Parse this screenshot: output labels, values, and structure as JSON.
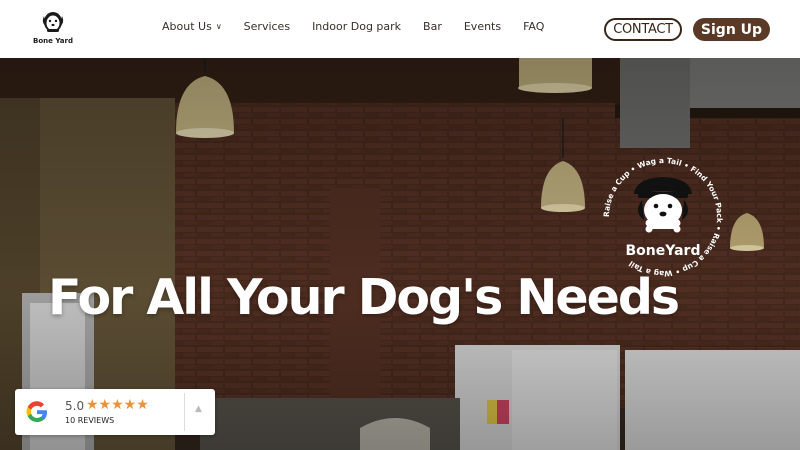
{
  "header": {
    "logo_text": "Bone Yard",
    "nav": [
      {
        "label": "About Us",
        "has_dropdown": true
      },
      {
        "label": "Services",
        "has_dropdown": false
      },
      {
        "label": "Indoor Dog park",
        "has_dropdown": false
      },
      {
        "label": "Bar",
        "has_dropdown": false
      },
      {
        "label": "Events",
        "has_dropdown": false
      },
      {
        "label": "FAQ",
        "has_dropdown": false
      }
    ],
    "contact_label": "CONTACT",
    "signup_label": "Sign Up",
    "dropdown_icon": "chevron-down-icon"
  },
  "hero": {
    "headline": "For All Your Dog's Needs",
    "badge": {
      "brand": "BoneYard",
      "ring_text": "Raise a Cup • Wag a Tail • Find Your Pack • Raise a Cup • Wag a Tail"
    }
  },
  "review_widget": {
    "rating": "5.0",
    "stars": "★★★★★",
    "reviews": "10 REVIEWS",
    "arrow": "▲"
  },
  "colors": {
    "brand_brown": "#5a3a26",
    "star": "#e8923a"
  }
}
